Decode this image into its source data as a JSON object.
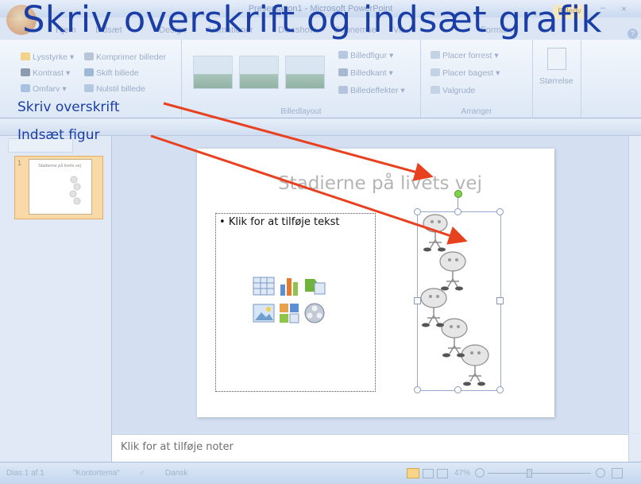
{
  "window": {
    "title": "Presentation1 - Microsoft PowerPoint",
    "context_tab": "Billedv",
    "minimize": "–",
    "close": "×"
  },
  "tabs": [
    "Hjem",
    "Indsæt",
    "Design",
    "Animationer",
    "Diasshow",
    "Gennemse",
    "Vis",
    "Formater"
  ],
  "ribbon": {
    "adjust": {
      "lysstyrke": "Lysstyrke",
      "kontrast": "Kontrast",
      "omfarv": "Omfarv",
      "komprimer": "Komprimer billeder",
      "skift": "Skift billede",
      "nulstil": "Nulstil billede"
    },
    "billedlayout_label": "Billedlayout",
    "billedfigur": "Billedfigur",
    "billedkant": "Billedkant",
    "billedeffekter": "Billedeffekter",
    "arrange": {
      "forrest": "Placer forrest",
      "bagest": "Placer bagest",
      "valgrude": "Valgrude",
      "label": "Arranger"
    },
    "size_label": "Størrelse"
  },
  "slide": {
    "title": "Stadierne på livets vej",
    "thumb_title": "Stadierne på livets vej",
    "thumb_number": "1",
    "bullet": "Klik for at tilføje tekst"
  },
  "notes_placeholder": "Klik for at tilføje noter",
  "status": {
    "slide_count": "Dias 1 af 1",
    "theme": "\"Kontortema\"",
    "language": "Dansk",
    "zoom": "47%"
  },
  "overlay": {
    "heading": "Skriv overskrift og indsæt grafik",
    "label_overskrift": "Skriv overskrift",
    "label_figur": "Indsæt figur"
  },
  "colors": {
    "arrow": "#e8411f",
    "overlay_text": "#1a3ea6",
    "selection": "#f9d9a8"
  }
}
